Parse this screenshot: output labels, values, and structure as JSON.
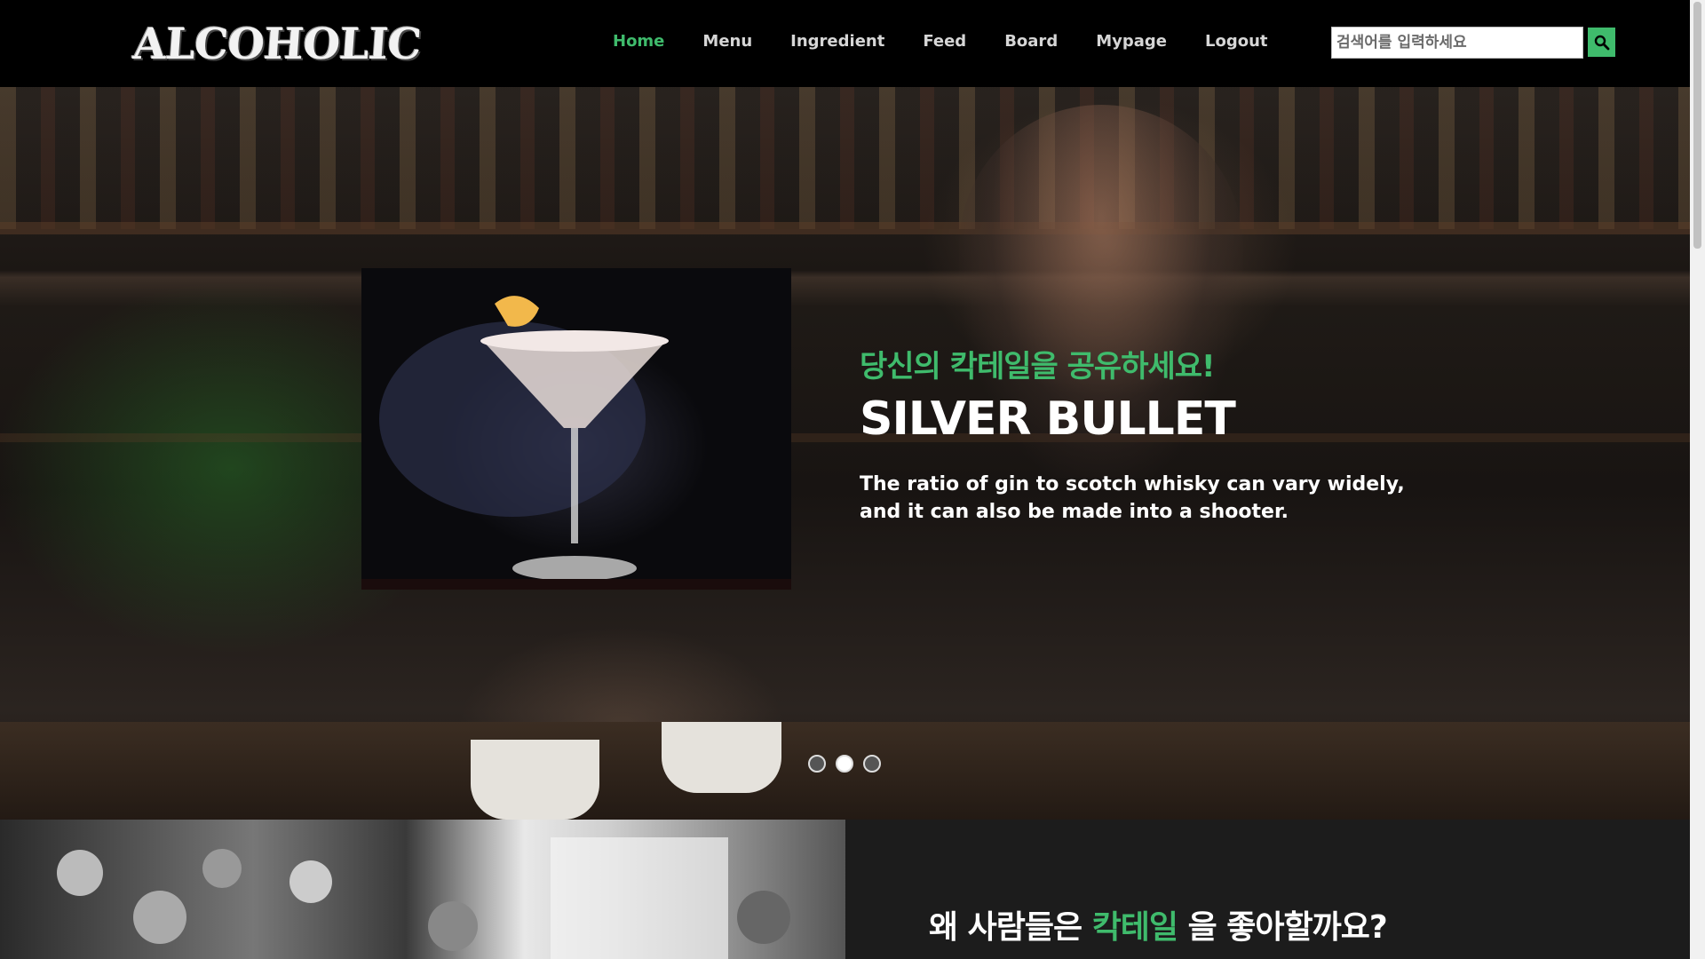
{
  "header": {
    "logo": "ALCOHOLIC",
    "nav": [
      {
        "label": "Home",
        "active": true
      },
      {
        "label": "Menu",
        "active": false
      },
      {
        "label": "Ingredient",
        "active": false
      },
      {
        "label": "Feed",
        "active": false
      },
      {
        "label": "Board",
        "active": false
      },
      {
        "label": "Mypage",
        "active": false
      },
      {
        "label": "Logout",
        "active": false
      }
    ],
    "search": {
      "placeholder": "검색어를 입력하세요",
      "button_icon": "search-icon"
    }
  },
  "hero": {
    "slide_subtitle": "당신의 칵테일을 공유하세요!",
    "slide_title": "SILVER BULLET",
    "slide_description": "The ratio of gin to scotch whisky can vary widely, and it can also be made into a shooter.",
    "dots": [
      {
        "active": false
      },
      {
        "active": true
      },
      {
        "active": false
      }
    ]
  },
  "section": {
    "why_prefix": "왜 사람들은",
    "why_accent": "칵테일",
    "why_suffix": "을 좋아할까요?"
  },
  "colors": {
    "accent": "#3fbb6c",
    "background": "#000000"
  }
}
